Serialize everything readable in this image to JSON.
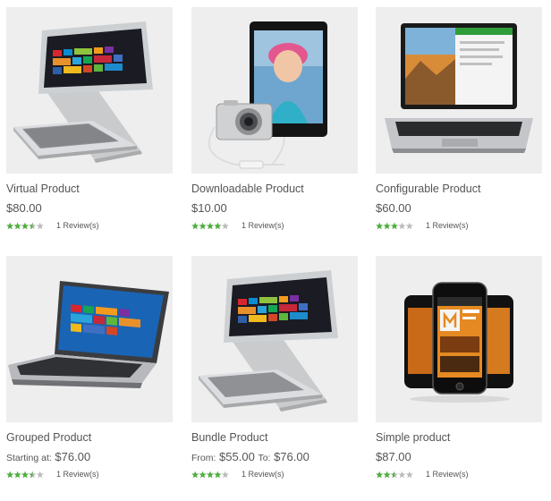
{
  "colors": {
    "image_bg": "#eeeeee",
    "star_on": "#4eae3d",
    "star_off": "#bbbbbb",
    "text": "#555555"
  },
  "products": [
    {
      "name": "Virtual Product",
      "price_label": "",
      "price": "$80.00",
      "price_to_label": "",
      "price_to": "",
      "rating": 3.5,
      "reviews": "1 Review(s)",
      "image": "convertible-laptop-icon"
    },
    {
      "name": "Downloadable Product",
      "price_label": "",
      "price": "$10.00",
      "price_to_label": "",
      "price_to": "",
      "rating": 4,
      "reviews": "1 Review(s)",
      "image": "tablet-camera-icon"
    },
    {
      "name": "Configurable Product",
      "price_label": "",
      "price": "$60.00",
      "price_to_label": "",
      "price_to": "",
      "rating": 3,
      "reviews": "1 Review(s)",
      "image": "hybrid-laptop-icon"
    },
    {
      "name": "Grouped Product",
      "price_label": "Starting at:",
      "price": "$76.00",
      "price_to_label": "",
      "price_to": "",
      "rating": 3.5,
      "reviews": "1 Review(s)",
      "image": "laptop-icon"
    },
    {
      "name": "Bundle Product",
      "price_label": "From:",
      "price": "$55.00",
      "price_to_label": "To:",
      "price_to": "$76.00",
      "rating": 4,
      "reviews": "1 Review(s)",
      "image": "convertible-laptop-icon"
    },
    {
      "name": "Simple product",
      "price_label": "",
      "price": "$87.00",
      "price_to_label": "",
      "price_to": "",
      "rating": 2.5,
      "reviews": "1 Review(s)",
      "image": "smartphones-icon"
    }
  ]
}
